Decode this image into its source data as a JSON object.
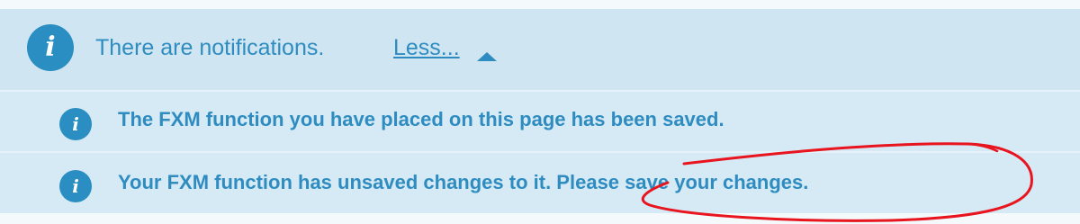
{
  "header": {
    "icon": "info-icon",
    "message": "There are notifications.",
    "toggle_label": "Less..."
  },
  "notifications": [
    {
      "icon": "info-icon",
      "text": "The FXM function you have placed on this page has been saved."
    },
    {
      "icon": "info-icon",
      "text": "Your FXM function has unsaved changes to it. Please save your changes."
    }
  ],
  "colors": {
    "accent": "#2a8ec2",
    "text": "#2f8cc0",
    "panel_bg": "#d4e9f4",
    "annotation": "#e8141e"
  }
}
